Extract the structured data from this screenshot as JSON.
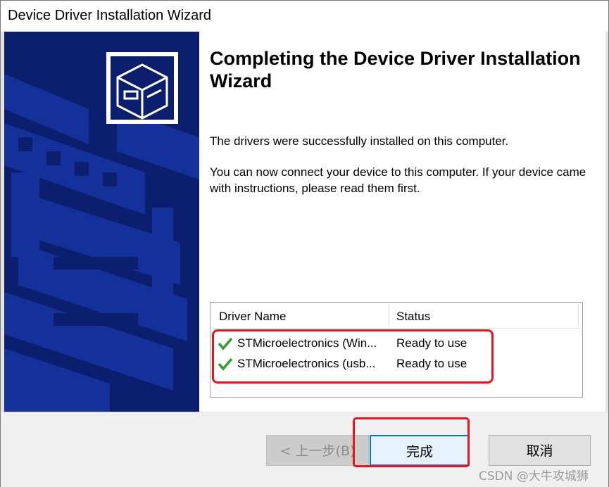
{
  "window": {
    "title": "Device Driver Installation Wizard"
  },
  "content": {
    "heading": "Completing the Device Driver Installation Wizard",
    "message1": "The drivers were successfully installed on this computer.",
    "message2": "You can now connect your device to this computer. If your device came with instructions, please read them first."
  },
  "driver_list": {
    "columns": [
      "Driver Name",
      "Status"
    ],
    "rows": [
      {
        "name": "STMicroelectronics (Win...",
        "status": "Ready to use",
        "icon": "check-icon"
      },
      {
        "name": "STMicroelectronics (usb...",
        "status": "Ready to use",
        "icon": "check-icon"
      }
    ]
  },
  "buttons": {
    "back": "< 上一步(B)",
    "finish": "完成",
    "cancel": "取消"
  },
  "watermark": "CSDN @大牛攻城狮",
  "colors": {
    "sidebar": "#0b1f6e",
    "check": "#2e9e2e",
    "annotation": "#e8141c",
    "accent": "#0078d7"
  }
}
